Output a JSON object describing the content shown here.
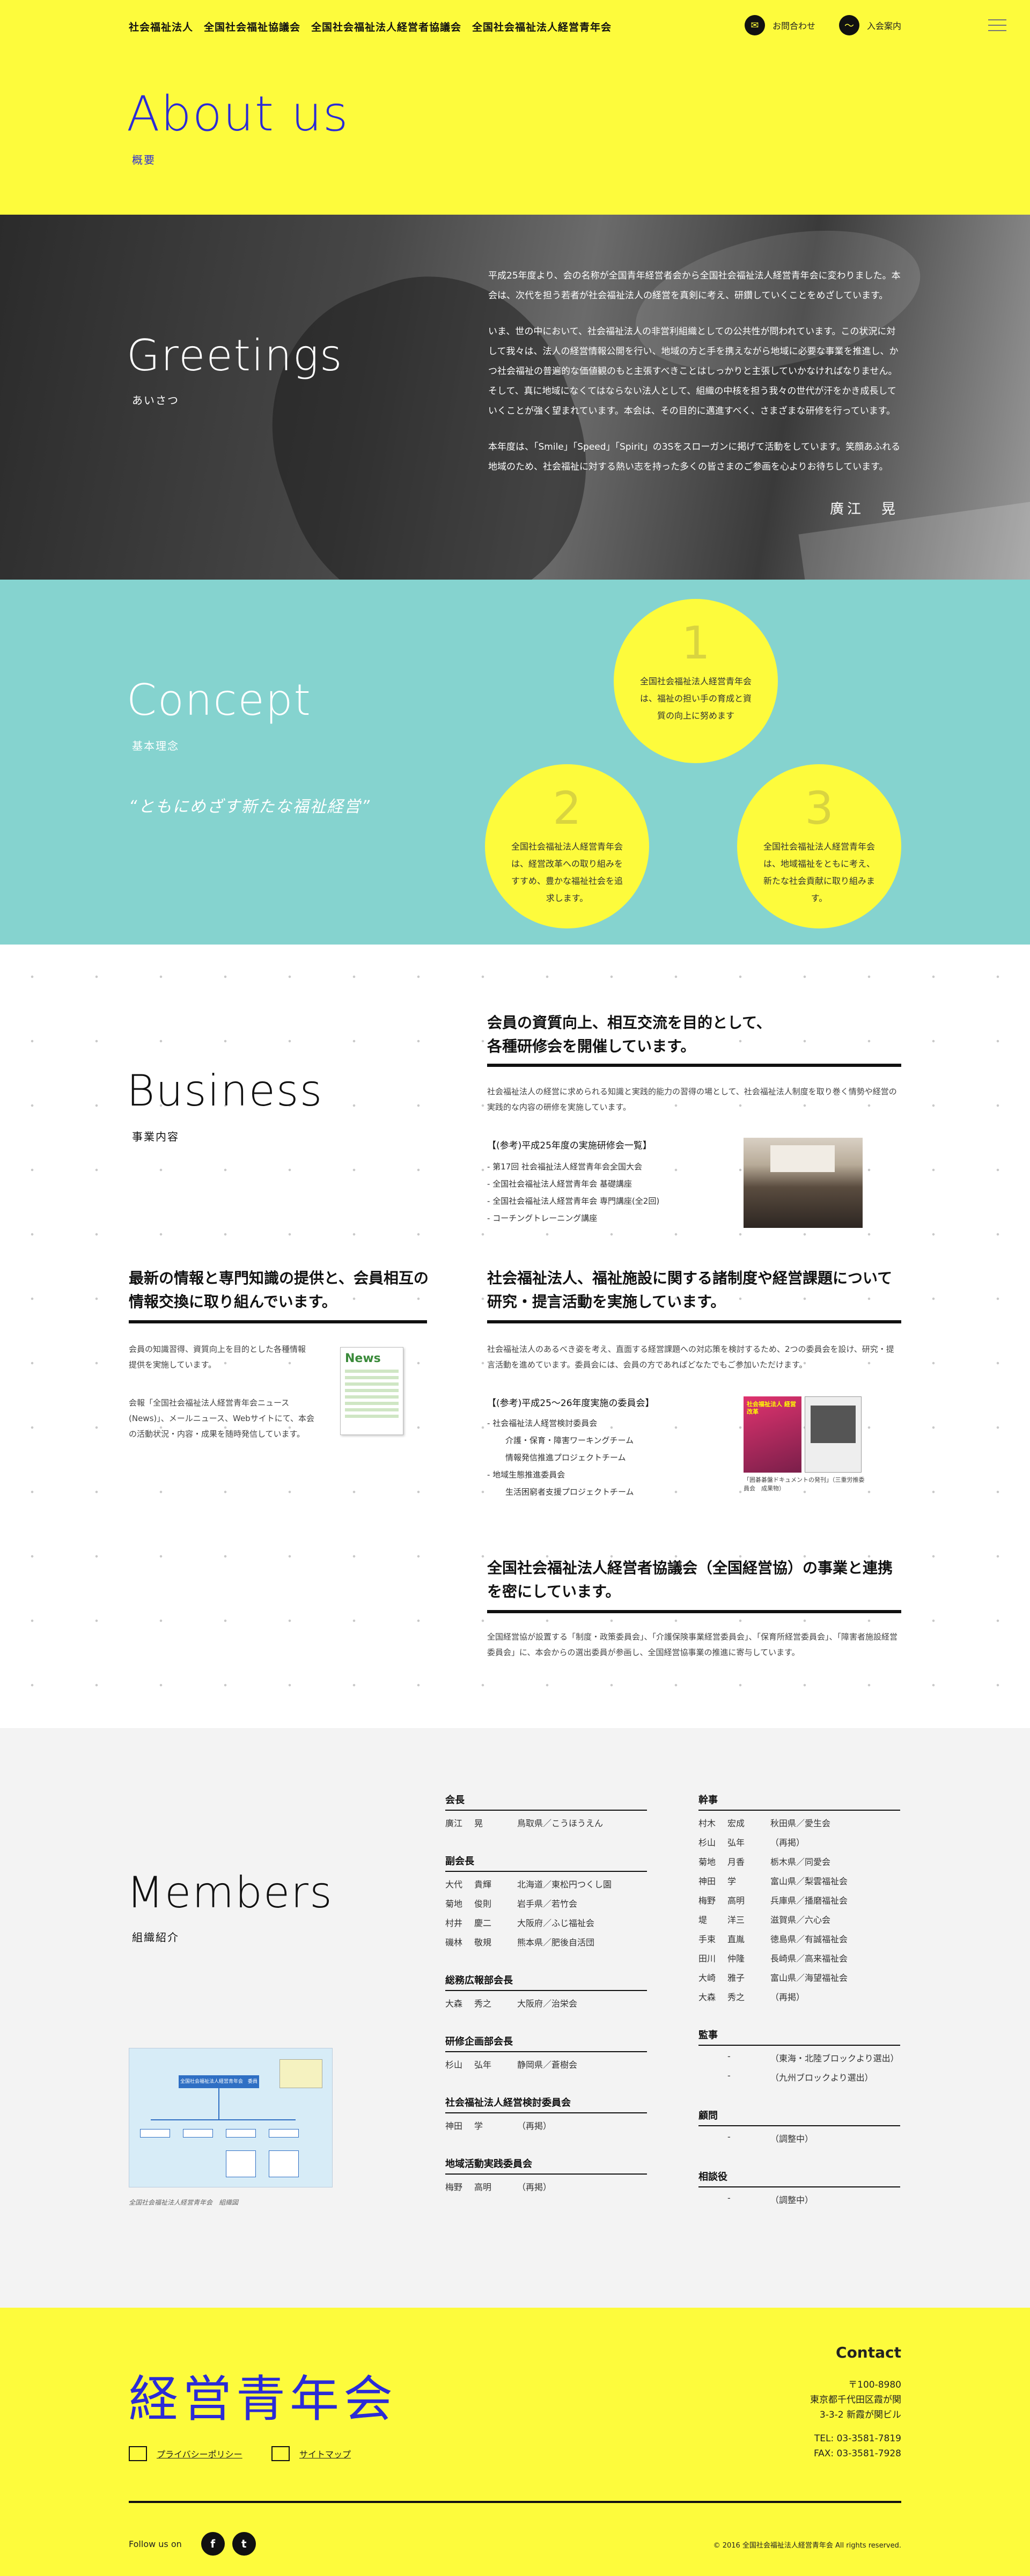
{
  "header": {
    "nav": "社会福祉法人　全国社会福祉協議会　全国社会福祉法人経営者協議会　全国社会福祉法人経営青年会",
    "contact_label": "お問合わせ",
    "join_label": "入会案内",
    "title": "About us",
    "subtitle": "概要"
  },
  "greetings": {
    "title": "Greetings",
    "subtitle": "あいさつ",
    "p1": "平成25年度より、会の名称が全国青年経営者会から全国社会福祉法人経営青年会に変わりました。本会は、次代を担う若者が社会福祉法人の経営を真剣に考え、研鑽していくことをめざしています。",
    "p2": "いま、世の中において、社会福祉法人の非営利組織としての公共性が問われています。この状況に対して我々は、法人の経営情報公開を行い、地域の方と手を携えながら地域に必要な事業を推進し、かつ社会福祉の普遍的な価値観のもと主張すべきことはしっかりと主張していかなければなりません。そして、真に地域になくてはならない法人として、組織の中核を担う我々の世代が汗をかき成長していくことが強く望まれています。本会は、その目的に邁進すべく、さまざまな研修を行っています。",
    "p3": "本年度は、「Smile」「Speed」「Spirit」の3Sをスローガンに掲げて活動をしています。笑顔あふれる地域のため、社会福祉に対する熱い志を持った多くの皆さまのご参画を心よりお待ちしています。",
    "signature": "廣江　晃"
  },
  "concept": {
    "title": "Concept",
    "subtitle": "基本理念",
    "catch": "“ともにめざす新たな福祉経営”",
    "items": [
      {
        "num": "1",
        "text": "全国社会福祉法人経営青年会は、福祉の担い手の育成と資質の向上に努めます"
      },
      {
        "num": "2",
        "text": "全国社会福祉法人経営青年会は、経営改革への取り組みをすすめ、豊かな福祉社会を追求します。"
      },
      {
        "num": "3",
        "text": "全国社会福祉法人経営青年会は、地域福祉をともに考え、新たな社会貢献に取り組みます。"
      }
    ]
  },
  "business": {
    "title": "Business",
    "subtitle": "事業内容",
    "b1": {
      "heading": "会員の資質向上、相互交流を目的として、各種研修会を開催しています。",
      "body": "社会福祉法人の経営に求められる知識と実践的能力の習得の場として、社会福祉法人制度を取り巻く情勢や経営の実践的な内容の研修を実施しています。",
      "ref": "【(参考)平成25年度の実施研修会一覧】",
      "list": [
        "第17回 社会福祉法人経営青年会全国大会",
        "全国社会福祉法人経営青年会 基礎講座",
        "全国社会福祉法人経営青年会 専門講座(全2回)",
        "コーチングトレーニング講座"
      ]
    },
    "b2": {
      "heading": "最新の情報と専門知識の提供と、会員相互の情報交換に取り組んでいます。",
      "body1": "会員の知識習得、資質向上を目的とした各種情報提供を実施しています。",
      "body2": "会報「全国社会福祉法人経営青年会ニュース(News)」、メールニュース、Webサイトにて、本会の活動状況・内容・成果を随時発信しています。",
      "news_label": "News"
    },
    "b3": {
      "heading": "社会福祉法人、福祉施設に関する諸制度や経営課題について研究・提言活動を実施しています。",
      "body": "社会福祉法人のあるべき姿を考え、直面する経営課題への対応策を検討するため、2つの委員会を設け、研究・提言活動を進めています。委員会には、会員の方であればどなたでもご参加いただけます。",
      "ref": "【(参考)平成25〜26年度実施の委員会】",
      "list": [
        "社会福祉法人経営検討委員会",
        "介護・保育・障害ワーキングチーム",
        "情報発信推進プロジェクトチーム",
        "地域生態推進委員会",
        "生活困窮者支援プロジェクトチーム"
      ],
      "caption": "「囲碁碁盤ドキュメントの発刊」（三重労推委員会　成果物）",
      "book_title": "社会福祉法人 経営改革"
    },
    "b4": {
      "heading": "全国社会福祉法人経営者協議会（全国経営協）の事業と連携を密にしています。",
      "body": "全国経営協が設置する「制度・政策委員会」、「介護保険事業経営委員会」、「保育所経営委員会」、「障害者施設経営委員会」に、本会からの選出委員が参画し、全国経営協事業の推進に寄与しています。"
    }
  },
  "members": {
    "title": "Members",
    "subtitle": "組織紹介",
    "org_caption": "全国社会福祉法人経営青年会　組織図",
    "org_chart_title": "全国社会福祉法人経営青年会　委員会",
    "groups_left": [
      {
        "title": "会長",
        "rows": [
          [
            "廣江",
            "晃",
            "鳥取県／こうほうえん"
          ]
        ]
      },
      {
        "title": "副会長",
        "rows": [
          [
            "大代",
            "貴輝",
            "北海道／東松円つくし園"
          ],
          [
            "菊地",
            "俊則",
            "岩手県／若竹会"
          ],
          [
            "村井",
            "慶二",
            "大阪府／ふじ福祉会"
          ],
          [
            "磯林",
            "敬規",
            "熊本県／肥後自活団"
          ]
        ]
      },
      {
        "title": "総務広報部会長",
        "rows": [
          [
            "大森",
            "秀之",
            "大阪府／治栄会"
          ]
        ]
      },
      {
        "title": "研修企画部会長",
        "rows": [
          [
            "杉山",
            "弘年",
            "静岡県／蒼樹会"
          ]
        ]
      },
      {
        "title": "社会福祉法人経営検討委員会",
        "rows": [
          [
            "神田",
            "学",
            "（再掲）"
          ]
        ]
      },
      {
        "title": "地域活動実践委員会",
        "rows": [
          [
            "梅野",
            "高明",
            "（再掲）"
          ]
        ]
      }
    ],
    "groups_right": [
      {
        "title": "幹事",
        "rows": [
          [
            "村木",
            "宏成",
            "秋田県／愛生会"
          ],
          [
            "杉山",
            "弘年",
            "（再掲）"
          ],
          [
            "菊地",
            "月香",
            "栃木県／同愛会"
          ],
          [
            "神田",
            "学",
            "富山県／梨雲福祉会"
          ],
          [
            "梅野",
            "高明",
            "兵庫県／播磨福祉会"
          ],
          [
            "堤",
            "洋三",
            "滋賀県／六心会"
          ],
          [
            "手束",
            "直胤",
            "徳島県／有誠福祉会"
          ],
          [
            "田川",
            "仲隆",
            "長崎県／高来福祉会"
          ],
          [
            "大崎",
            "雅子",
            "富山県／海望福祉会"
          ],
          [
            "大森",
            "秀之",
            "（再掲）"
          ]
        ]
      },
      {
        "title": "監事",
        "rows": [
          [
            "",
            "-",
            "（東海・北陸ブロックより選出）"
          ],
          [
            "",
            "-",
            "（九州ブロックより選出）"
          ]
        ]
      },
      {
        "title": "顧問",
        "rows": [
          [
            "",
            "-",
            "（調整中）"
          ]
        ]
      },
      {
        "title": "相談役",
        "rows": [
          [
            "",
            "-",
            "（調整中）"
          ]
        ]
      }
    ]
  },
  "footer": {
    "logo": "経営青年会",
    "privacy": "プライバシーポリシー",
    "sitemap": "サイトマップ",
    "contact_title": "Contact",
    "zip": "〒100-8980",
    "addr1": "東京都千代田区霞が関",
    "addr2": "3-3-2 新霞が関ビル",
    "tel": "TEL: 03-3581-7819",
    "fax": "FAX: 03-3581-7928",
    "follow": "Follow us on",
    "fb": "f",
    "tw": "t",
    "copyright": "© 2016 全国社会福祉法人経営青年会 All rights reserved."
  },
  "colors": {
    "yellow": "#fdfb3c",
    "blue": "#2b2bd6",
    "teal": "#85d3cf"
  }
}
